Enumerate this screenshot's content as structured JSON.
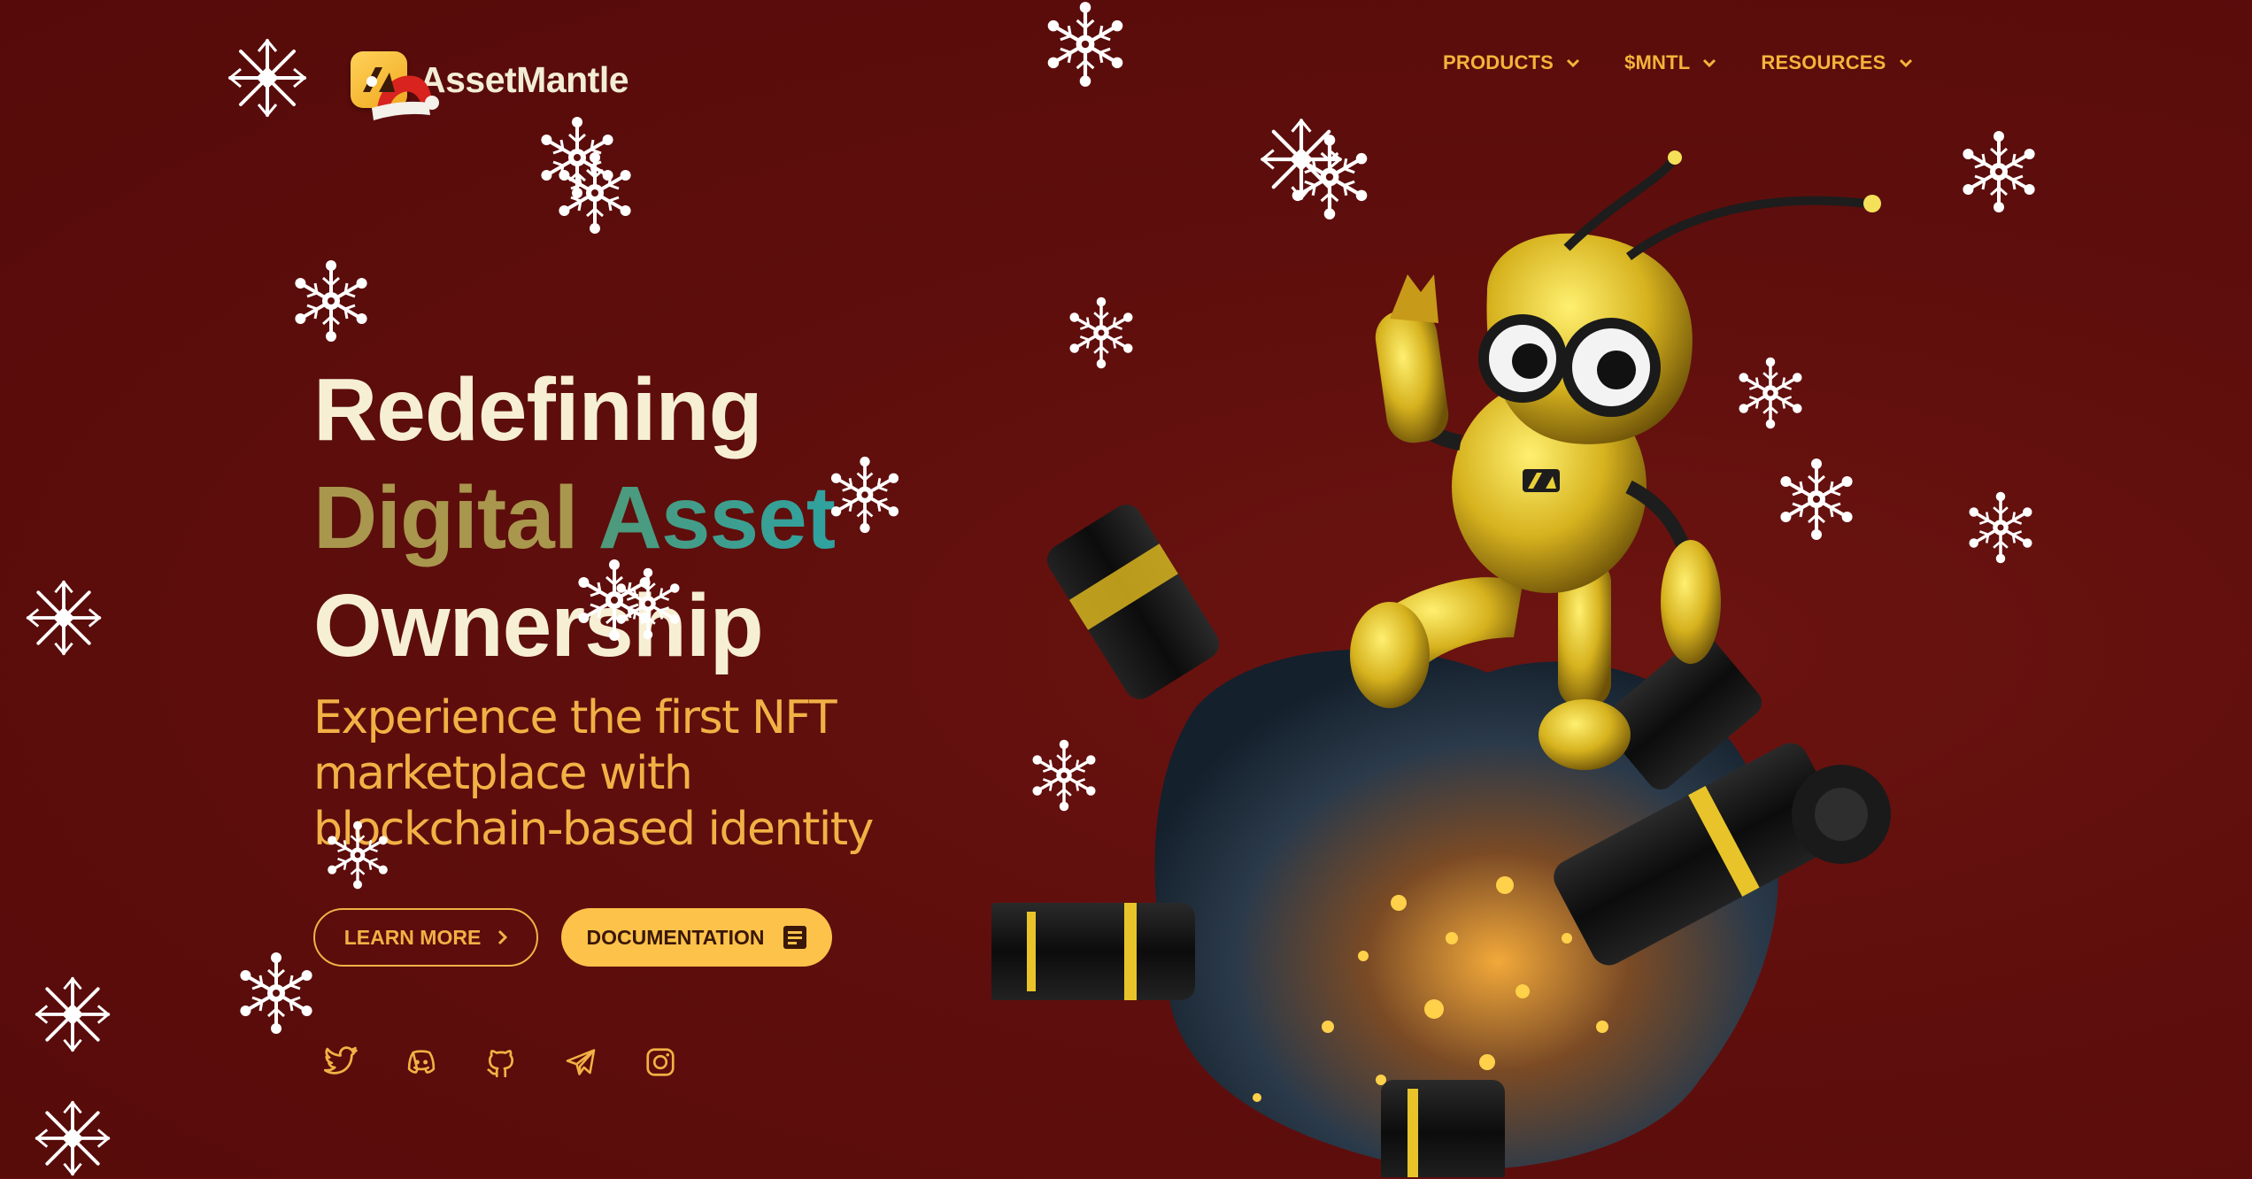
{
  "brand": {
    "name": "AssetMantle"
  },
  "nav": {
    "items": [
      {
        "label": "PRODUCTS"
      },
      {
        "label": "$MNTL"
      },
      {
        "label": "RESOURCES"
      }
    ]
  },
  "hero": {
    "title_line1": "Redefining",
    "title_line2a": "Digital",
    "title_line2b": "Asset",
    "title_line3": "Ownership",
    "subtitle_line1": "Experience the first NFT",
    "subtitle_line2": "marketplace with",
    "subtitle_line3": "blockchain-based identity"
  },
  "buttons": {
    "learn_more": "LEARN MORE",
    "documentation": "DOCUMENTATION"
  },
  "socials": [
    "twitter-icon",
    "discord-icon",
    "github-icon",
    "telegram-icon",
    "instagram-icon"
  ],
  "colors": {
    "background": "#5e0e0c",
    "accent": "#f5b33a",
    "button_fill": "#fcc24a",
    "title_cream": "#f7efd4",
    "teal": "#2fa2a0"
  }
}
